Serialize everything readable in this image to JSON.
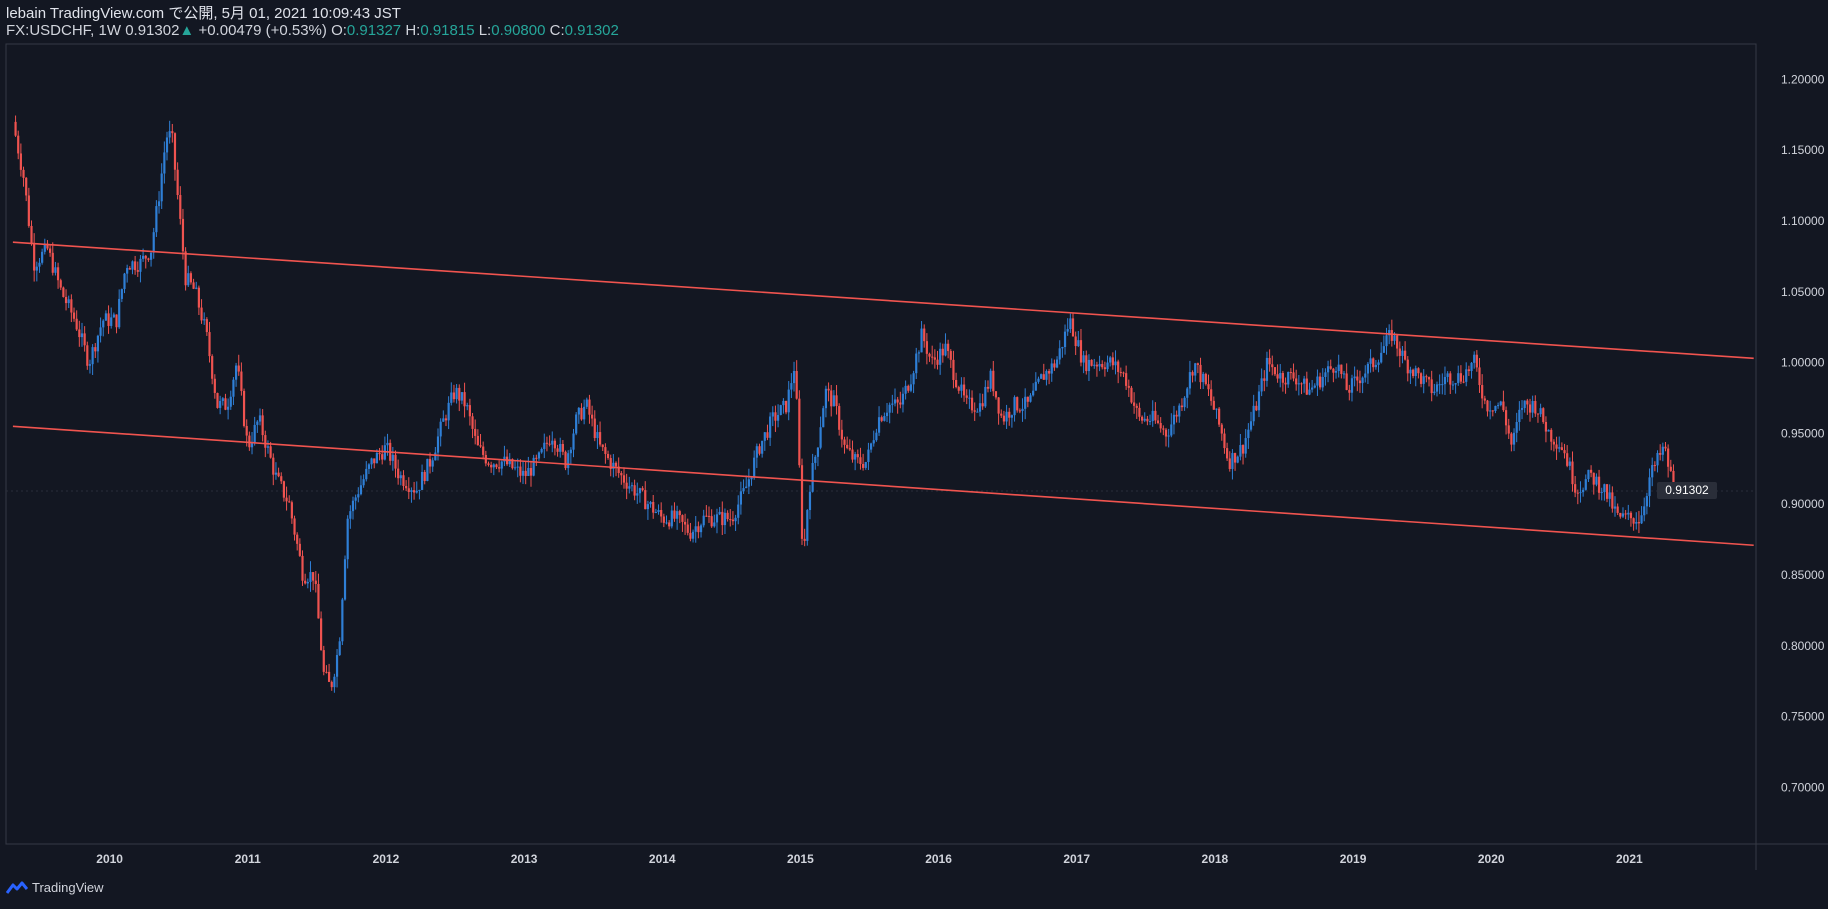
{
  "header": {
    "title": "lebain TradingView.com で公開, 5月 01, 2021 10:09:43 JST",
    "symbol": "FX:USDCHF, 1W",
    "last": "0.91302",
    "change": "+0.00479 (+0.53%)",
    "o_label": "O:",
    "o_value": "0.91327",
    "h_label": "H:",
    "h_value": "0.91815",
    "l_label": "L:",
    "l_value": "0.90800",
    "c_label": "C:",
    "c_value": "0.91302"
  },
  "brand": "TradingView",
  "colors": {
    "background": "#131722",
    "up": "#2f7fd6",
    "down": "#ef5350",
    "trendline": "#f0544f",
    "text": "#d1d4dc",
    "accent": "#26a69a"
  },
  "chart_data": {
    "type": "candlestick",
    "symbol": "FX:USDCHF",
    "interval": "1W",
    "x_ticks": [
      "2010",
      "2011",
      "2012",
      "2013",
      "2014",
      "2015",
      "2016",
      "2017",
      "2018",
      "2019",
      "2020",
      "2021"
    ],
    "x_range": [
      "2009-04",
      "2021-12"
    ],
    "y_ticks": [
      "1.20000",
      "1.15000",
      "1.10000",
      "1.05000",
      "1.00000",
      "0.95000",
      "0.90000",
      "0.85000",
      "0.80000",
      "0.75000",
      "0.70000"
    ],
    "y_range": [
      0.66,
      1.225
    ],
    "current_price": "0.91302",
    "grid": false,
    "series_path": [
      [
        2009.3,
        1.17
      ],
      [
        2009.38,
        1.13
      ],
      [
        2009.45,
        1.07
      ],
      [
        2009.55,
        1.08
      ],
      [
        2009.65,
        1.05
      ],
      [
        2009.75,
        1.03
      ],
      [
        2009.85,
        1.0
      ],
      [
        2009.95,
        1.03
      ],
      [
        2010.05,
        1.03
      ],
      [
        2010.12,
        1.07
      ],
      [
        2010.22,
        1.07
      ],
      [
        2010.3,
        1.08
      ],
      [
        2010.36,
        1.12
      ],
      [
        2010.41,
        1.16
      ],
      [
        2010.45,
        1.16
      ],
      [
        2010.52,
        1.09
      ],
      [
        2010.55,
        1.06
      ],
      [
        2010.62,
        1.05
      ],
      [
        2010.7,
        1.02
      ],
      [
        2010.78,
        0.97
      ],
      [
        2010.85,
        0.97
      ],
      [
        2010.92,
        1.0
      ],
      [
        2011.0,
        0.94
      ],
      [
        2011.08,
        0.96
      ],
      [
        2011.2,
        0.92
      ],
      [
        2011.3,
        0.9
      ],
      [
        2011.4,
        0.85
      ],
      [
        2011.48,
        0.85
      ],
      [
        2011.55,
        0.78
      ],
      [
        2011.6,
        0.77
      ],
      [
        2011.66,
        0.8
      ],
      [
        2011.72,
        0.89
      ],
      [
        2011.8,
        0.91
      ],
      [
        2011.9,
        0.93
      ],
      [
        2012.0,
        0.94
      ],
      [
        2012.1,
        0.92
      ],
      [
        2012.22,
        0.91
      ],
      [
        2012.32,
        0.93
      ],
      [
        2012.42,
        0.96
      ],
      [
        2012.5,
        0.98
      ],
      [
        2012.58,
        0.97
      ],
      [
        2012.66,
        0.94
      ],
      [
        2012.75,
        0.93
      ],
      [
        2012.85,
        0.93
      ],
      [
        2013.0,
        0.92
      ],
      [
        2013.1,
        0.93
      ],
      [
        2013.2,
        0.95
      ],
      [
        2013.3,
        0.93
      ],
      [
        2013.38,
        0.96
      ],
      [
        2013.45,
        0.97
      ],
      [
        2013.55,
        0.94
      ],
      [
        2013.62,
        0.93
      ],
      [
        2013.7,
        0.92
      ],
      [
        2013.8,
        0.91
      ],
      [
        2013.9,
        0.9
      ],
      [
        2014.0,
        0.89
      ],
      [
        2014.1,
        0.89
      ],
      [
        2014.2,
        0.88
      ],
      [
        2014.3,
        0.89
      ],
      [
        2014.4,
        0.89
      ],
      [
        2014.5,
        0.89
      ],
      [
        2014.6,
        0.91
      ],
      [
        2014.7,
        0.94
      ],
      [
        2014.8,
        0.96
      ],
      [
        2014.9,
        0.97
      ],
      [
        2014.96,
        1.0
      ],
      [
        2015.02,
        0.86
      ],
      [
        2015.06,
        0.91
      ],
      [
        2015.12,
        0.94
      ],
      [
        2015.18,
        0.98
      ],
      [
        2015.25,
        0.97
      ],
      [
        2015.32,
        0.94
      ],
      [
        2015.4,
        0.93
      ],
      [
        2015.48,
        0.93
      ],
      [
        2015.56,
        0.96
      ],
      [
        2015.64,
        0.97
      ],
      [
        2015.72,
        0.97
      ],
      [
        2015.8,
        0.99
      ],
      [
        2015.88,
        1.02
      ],
      [
        2015.95,
        1.0
      ],
      [
        2016.05,
        1.01
      ],
      [
        2016.12,
        0.99
      ],
      [
        2016.2,
        0.97
      ],
      [
        2016.3,
        0.97
      ],
      [
        2016.38,
        0.99
      ],
      [
        2016.46,
        0.96
      ],
      [
        2016.55,
        0.97
      ],
      [
        2016.65,
        0.97
      ],
      [
        2016.75,
        0.99
      ],
      [
        2016.85,
        1.0
      ],
      [
        2016.95,
        1.03
      ],
      [
        2017.05,
        1.0
      ],
      [
        2017.15,
        1.0
      ],
      [
        2017.25,
        1.0
      ],
      [
        2017.35,
        0.99
      ],
      [
        2017.45,
        0.96
      ],
      [
        2017.55,
        0.96
      ],
      [
        2017.65,
        0.95
      ],
      [
        2017.75,
        0.97
      ],
      [
        2017.85,
        1.0
      ],
      [
        2017.95,
        0.98
      ],
      [
        2018.05,
        0.95
      ],
      [
        2018.1,
        0.93
      ],
      [
        2018.2,
        0.94
      ],
      [
        2018.3,
        0.97
      ],
      [
        2018.38,
        1.0
      ],
      [
        2018.48,
        0.99
      ],
      [
        2018.58,
        0.99
      ],
      [
        2018.68,
        0.98
      ],
      [
        2018.78,
        0.99
      ],
      [
        2018.88,
        1.0
      ],
      [
        2018.96,
        0.98
      ],
      [
        2019.05,
        0.99
      ],
      [
        2019.15,
        1.0
      ],
      [
        2019.28,
        1.02
      ],
      [
        2019.38,
        1.0
      ],
      [
        2019.48,
        0.99
      ],
      [
        2019.58,
        0.98
      ],
      [
        2019.68,
        0.99
      ],
      [
        2019.78,
        0.99
      ],
      [
        2019.88,
        1.0
      ],
      [
        2019.96,
        0.97
      ],
      [
        2020.08,
        0.97
      ],
      [
        2020.15,
        0.94
      ],
      [
        2020.22,
        0.97
      ],
      [
        2020.32,
        0.97
      ],
      [
        2020.42,
        0.95
      ],
      [
        2020.52,
        0.94
      ],
      [
        2020.62,
        0.91
      ],
      [
        2020.72,
        0.92
      ],
      [
        2020.82,
        0.91
      ],
      [
        2020.92,
        0.89
      ],
      [
        2021.0,
        0.89
      ],
      [
        2021.08,
        0.89
      ],
      [
        2021.15,
        0.92
      ],
      [
        2021.25,
        0.94
      ],
      [
        2021.3,
        0.92
      ],
      [
        2021.33,
        0.913
      ]
    ],
    "trendlines": [
      {
        "name": "upper",
        "from": [
          2009.3,
          1.085
        ],
        "to": [
          2021.9,
          1.003
        ]
      },
      {
        "name": "lower",
        "from": [
          2009.3,
          0.955
        ],
        "to": [
          2021.9,
          0.871
        ]
      }
    ]
  }
}
